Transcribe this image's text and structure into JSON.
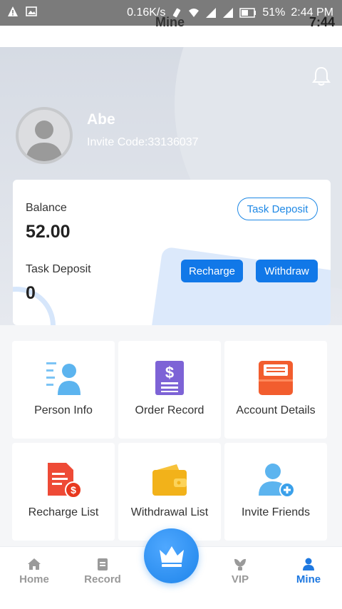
{
  "status_bar": {
    "speed": "0.16K/s",
    "battery": "51%",
    "time": "2:44 PM"
  },
  "header": {
    "title": "Mine",
    "time": "7:44"
  },
  "profile": {
    "username": "Abe",
    "invite_code": "Invite Code:33136037"
  },
  "balance_card": {
    "balance_label": "Balance",
    "balance_value": "52.00",
    "task_deposit_label": "Task Deposit",
    "task_deposit_value": "0",
    "task_deposit_button": "Task Deposit",
    "recharge_button": "Recharge",
    "withdraw_button": "Withdraw"
  },
  "grid": [
    {
      "label": "Person Info",
      "icon": "person-info-icon"
    },
    {
      "label": "Order Record",
      "icon": "order-record-icon"
    },
    {
      "label": "Account Details",
      "icon": "account-details-icon"
    },
    {
      "label": "Recharge List",
      "icon": "recharge-list-icon"
    },
    {
      "label": "Withdrawal List",
      "icon": "wallet-icon"
    },
    {
      "label": "Invite Friends",
      "icon": "invite-friends-icon"
    }
  ],
  "bottom_nav": {
    "items": [
      {
        "label": "Home",
        "icon": "home-icon"
      },
      {
        "label": "Record",
        "icon": "record-icon"
      },
      {
        "label": "VIP",
        "icon": "vip-icon"
      },
      {
        "label": "Mine",
        "icon": "user-icon"
      }
    ],
    "center_icon": "crown-icon"
  },
  "colors": {
    "accent": "#1178e8",
    "nav_active": "#1e78e0"
  }
}
